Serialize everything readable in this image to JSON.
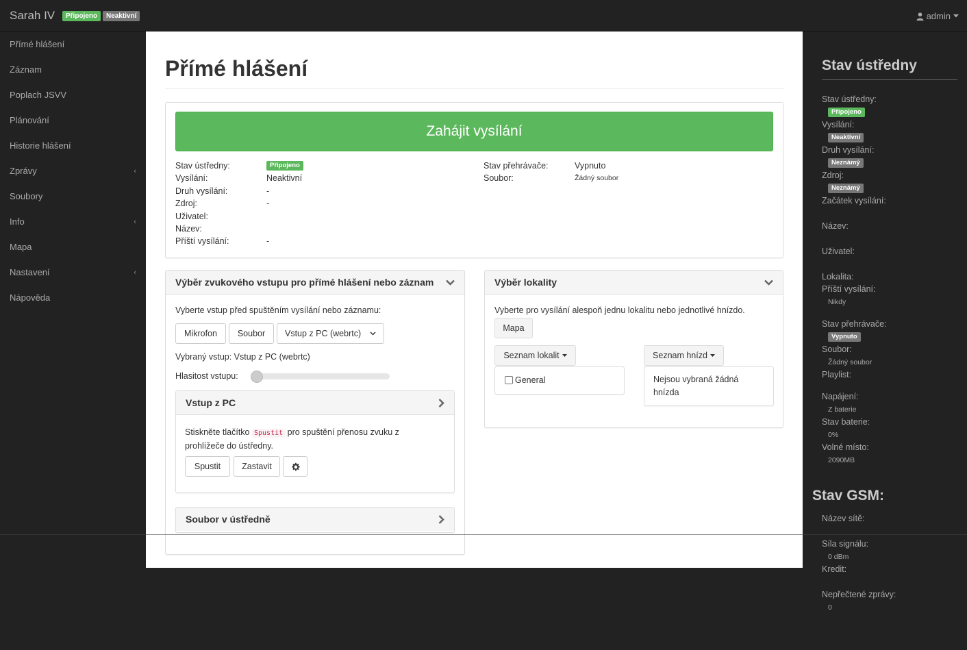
{
  "topbar": {
    "brand": "Sarah IV",
    "badge_connected": "Připojeno",
    "badge_inactive": "Neaktivní",
    "user": "admin",
    "colors": {
      "success": "#5cb85c",
      "default": "#777777",
      "background": "#222222"
    }
  },
  "sidebar": {
    "items": [
      {
        "label": "Přímé hlášení",
        "has_submenu": false
      },
      {
        "label": "Záznam",
        "has_submenu": false
      },
      {
        "label": "Poplach JSVV",
        "has_submenu": false
      },
      {
        "label": "Plánování",
        "has_submenu": false
      },
      {
        "label": "Historie hlášení",
        "has_submenu": false
      },
      {
        "label": "Zprávy",
        "has_submenu": true
      },
      {
        "label": "Soubory",
        "has_submenu": false
      },
      {
        "label": "Info",
        "has_submenu": true
      },
      {
        "label": "Mapa",
        "has_submenu": false
      },
      {
        "label": "Nastavení",
        "has_submenu": true
      },
      {
        "label": "Nápověda",
        "has_submenu": false
      }
    ]
  },
  "main": {
    "title": "Přímé hlášení",
    "start_button": "Zahájit vysílání",
    "status_left": {
      "k_central": "Stav ústředny:",
      "v_central": "Připojeno",
      "k_broadcast": "Vysílání:",
      "v_broadcast": "Neaktivní",
      "k_type": "Druh vysílání:",
      "v_type": "-",
      "k_source": "Zdroj:",
      "v_source": "-",
      "k_user": "Uživatel:",
      "k_name": "Název:",
      "k_next": "Příští vysílání:",
      "v_next": "-"
    },
    "status_right": {
      "k_player": "Stav přehrávače:",
      "v_player": "Vypnuto",
      "k_file": "Soubor:",
      "v_file": "Žádný soubor"
    },
    "input_panel": {
      "title": "Výběr zvukového vstupu pro přímé hlášení nebo záznam",
      "instruction": "Vyberte vstup před spuštěním vysílání nebo záznamu:",
      "btn_mic": "Mikrofon",
      "btn_file": "Soubor",
      "select_value": "Vstup z PC (webrtc)",
      "selected_text": "Vybraný vstup: Vstup z PC (webrtc)",
      "volume_label": "Hlasitost vstupu:",
      "volume_level": 0,
      "pc_title": "Vstup z PC",
      "pc_text_before": "Stiskněte tlačítko",
      "pc_code": "Spustit",
      "pc_text_after": "pro spuštění přenosu zvuku z",
      "pc_text_line2": "prohlížeče do ústředny.",
      "btn_run": "Spustit",
      "btn_stop": "Zastavit",
      "file_title": "Soubor v ústředně"
    },
    "location_panel": {
      "title": "Výběr lokality",
      "instruction": "Vyberte pro vysílání alespoň jednu lokalitu nebo jednotlivé hnízdo.",
      "btn_map": "Mapa",
      "dd_localities": "Seznam lokalit",
      "dd_nests": "Seznam hnízd",
      "locality_general": "General",
      "no_nests_line1": "Nejsou vybraná žádná",
      "no_nests_line2": "hnízda"
    }
  },
  "right_panel": {
    "title": "Stav ústředny",
    "k_central": "Stav ústředny:",
    "v_central": "Připojeno",
    "k_broadcast": "Vysílání:",
    "v_broadcast": "Neaktivní",
    "k_type": "Druh vysílání:",
    "v_type": "Neznámý",
    "k_source": "Zdroj:",
    "v_source": "Neznámý",
    "k_start": "Začátek vysílání:",
    "k_name": "Název:",
    "k_user": "Uživatel:",
    "k_locality": "Lokalita:",
    "k_next": "Příští vysílání:",
    "v_next": "Nikdy",
    "k_player": "Stav přehrávače:",
    "v_player": "Vypnuto",
    "k_file": "Soubor:",
    "v_file": "Žádný soubor",
    "k_playlist": "Playlist:",
    "k_power": "Napájení:",
    "v_power": "Z baterie",
    "k_battery": "Stav baterie:",
    "v_battery": "0%",
    "k_space": "Volné místo:",
    "v_space": "2090MB",
    "gsm_title": "Stav GSM:",
    "k_network": "Název sítě:",
    "k_signal": "Síla signálu:",
    "v_signal": "0 dBm",
    "k_credit": "Kredit:",
    "k_unread": "Nepřečtené zprávy:",
    "v_unread": "0"
  }
}
